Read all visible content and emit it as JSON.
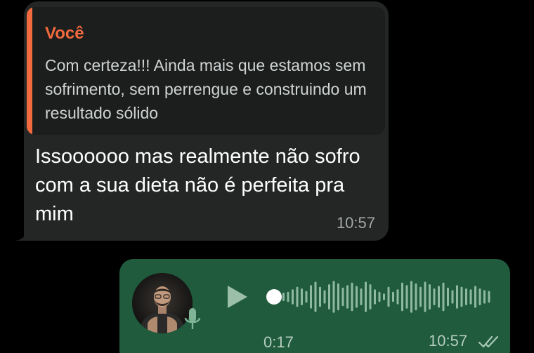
{
  "incoming": {
    "reply_author": "Você",
    "reply_text": "Com certeza!!! Ainda mais que estamos sem sofrimento, sem perrengue e construindo um resultado sólido",
    "text": "Issoooooo mas realmente não sofro com a sua dieta não é perfeita pra mim",
    "time": "10:57"
  },
  "outgoing_voice": {
    "duration": "0:17",
    "time": "10:57",
    "status_icon": "double-check-icon",
    "played_fraction": 0.0,
    "waveform_levels": [
      0.25,
      0.3,
      0.45,
      0.6,
      0.5,
      0.35,
      0.7,
      0.9,
      0.6,
      0.4,
      0.75,
      0.95,
      0.8,
      0.55,
      0.7,
      0.85,
      0.65,
      0.5,
      0.9,
      0.75,
      0.45,
      0.3,
      0.2,
      0.6,
      0.3,
      0.45,
      0.85,
      0.7,
      0.95,
      0.8,
      0.6,
      0.9,
      0.75,
      0.5,
      0.65,
      0.85,
      0.55,
      0.4,
      0.7,
      0.6,
      0.5,
      0.45,
      0.65,
      0.5,
      0.4,
      0.35
    ]
  },
  "colors": {
    "background": "#000000",
    "incoming_bubble": "#242626",
    "outgoing_bubble": "#1f5b3c",
    "quote_accent": "#f26a3d"
  }
}
